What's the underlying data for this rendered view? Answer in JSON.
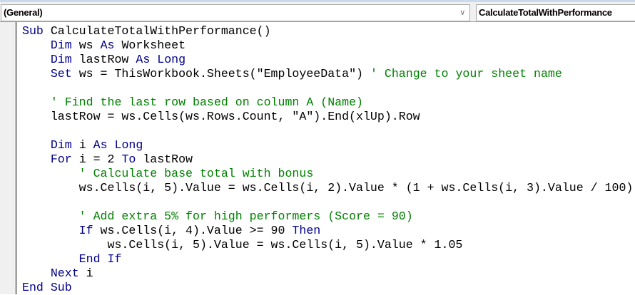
{
  "toolbar": {
    "object_combo": "(General)",
    "procedure_combo": "CalculateTotalWithPerformance"
  },
  "colors": {
    "keyword": "#00008b",
    "comment": "#008000",
    "text": "#000000"
  },
  "code": [
    [
      [
        "kw",
        "Sub "
      ],
      [
        "tx",
        "CalculateTotalWithPerformance()"
      ]
    ],
    [
      [
        "tx",
        "    "
      ],
      [
        "kw",
        "Dim "
      ],
      [
        "tx",
        "ws "
      ],
      [
        "kw",
        "As "
      ],
      [
        "tx",
        "Worksheet"
      ]
    ],
    [
      [
        "tx",
        "    "
      ],
      [
        "kw",
        "Dim "
      ],
      [
        "tx",
        "lastRow "
      ],
      [
        "kw",
        "As Long"
      ]
    ],
    [
      [
        "tx",
        "    "
      ],
      [
        "kw",
        "Set "
      ],
      [
        "tx",
        "ws = ThisWorkbook.Sheets(\"EmployeeData\") "
      ],
      [
        "cm",
        "' Change to your sheet name"
      ]
    ],
    [],
    [
      [
        "tx",
        "    "
      ],
      [
        "cm",
        "' Find the last row based on column A (Name)"
      ]
    ],
    [
      [
        "tx",
        "    lastRow = ws.Cells(ws.Rows.Count, \"A\").End(xlUp).Row"
      ]
    ],
    [],
    [
      [
        "tx",
        "    "
      ],
      [
        "kw",
        "Dim "
      ],
      [
        "tx",
        "i "
      ],
      [
        "kw",
        "As Long"
      ]
    ],
    [
      [
        "tx",
        "    "
      ],
      [
        "kw",
        "For "
      ],
      [
        "tx",
        "i = 2 "
      ],
      [
        "kw",
        "To "
      ],
      [
        "tx",
        "lastRow"
      ]
    ],
    [
      [
        "tx",
        "        "
      ],
      [
        "cm",
        "' Calculate base total with bonus"
      ]
    ],
    [
      [
        "tx",
        "        ws.Cells(i, 5).Value = ws.Cells(i, 2).Value * (1 + ws.Cells(i, 3).Value / 100)"
      ]
    ],
    [],
    [
      [
        "tx",
        "        "
      ],
      [
        "cm",
        "' Add extra 5% for high performers (Score = 90)"
      ]
    ],
    [
      [
        "tx",
        "        "
      ],
      [
        "kw",
        "If "
      ],
      [
        "tx",
        "ws.Cells(i, 4).Value >= 90 "
      ],
      [
        "kw",
        "Then"
      ]
    ],
    [
      [
        "tx",
        "            ws.Cells(i, 5).Value = ws.Cells(i, 5).Value * 1.05"
      ]
    ],
    [
      [
        "tx",
        "        "
      ],
      [
        "kw",
        "End If"
      ]
    ],
    [
      [
        "tx",
        "    "
      ],
      [
        "kw",
        "Next "
      ],
      [
        "tx",
        "i"
      ]
    ],
    [
      [
        "kw",
        "End Sub"
      ]
    ]
  ]
}
